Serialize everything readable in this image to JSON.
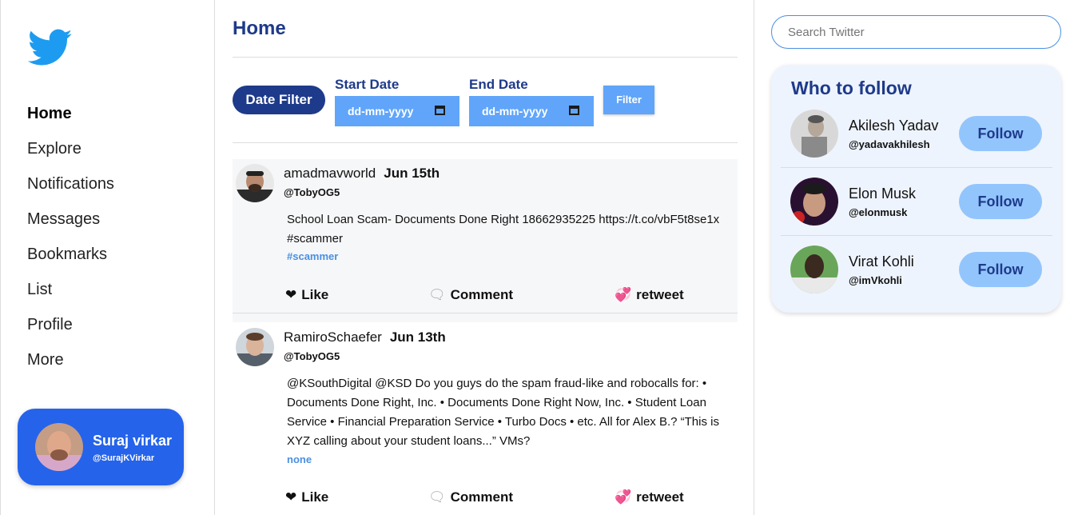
{
  "sidebar": {
    "items": [
      {
        "label": "Home",
        "active": true
      },
      {
        "label": "Explore"
      },
      {
        "label": "Notifications"
      },
      {
        "label": "Messages"
      },
      {
        "label": "Bookmarks"
      },
      {
        "label": "List"
      },
      {
        "label": "Profile"
      },
      {
        "label": "More"
      }
    ],
    "user": {
      "name": "Suraj virkar",
      "handle": "@SurajKVirkar"
    }
  },
  "main": {
    "title": "Home",
    "filter": {
      "button_label": "Date Filter",
      "start_label": "Start Date",
      "end_label": "End Date",
      "start_placeholder": "dd-mm-yyyy",
      "end_placeholder": "dd-mm-yyyy",
      "submit_label": "Filter"
    },
    "tweets": [
      {
        "username": "amadmavworld",
        "date": "Jun 15th",
        "handle": "@TobyOG5",
        "text": "School Loan Scam- Documents Done Right 18662935225 https://t.co/vbF5t8se1x #scammer",
        "tag": "#scammer",
        "like": "Like",
        "comment": "Comment",
        "retweet": "retweet"
      },
      {
        "username": "RamiroSchaefer",
        "date": "Jun 13th",
        "handle": "@TobyOG5",
        "text": "@KSouthDigital @KSD Do you guys do the spam fraud-like and robocalls for: • Documents Done Right, Inc. • Documents Done Right Now, Inc. • Student Loan Service • Financial Preparation Service • Turbo Docs • etc. All for Alex B.? “This is XYZ calling about your student loans...” VMs?",
        "tag": "none",
        "like": "Like",
        "comment": "Comment",
        "retweet": "retweet"
      }
    ]
  },
  "right": {
    "search_placeholder": "Search Twitter",
    "who_to_follow_title": "Who to follow",
    "follow_label": "Follow",
    "suggestions": [
      {
        "name": "Akilesh Yadav",
        "handle": "@yadavakhilesh"
      },
      {
        "name": "Elon Musk",
        "handle": "@elonmusk"
      },
      {
        "name": "Virat Kohli",
        "handle": "@imVkohli"
      }
    ]
  },
  "colors": {
    "accent": "#1e3a8a",
    "brand": "#1d9bf0",
    "button": "#60a5fa",
    "card": "#2563eb"
  }
}
